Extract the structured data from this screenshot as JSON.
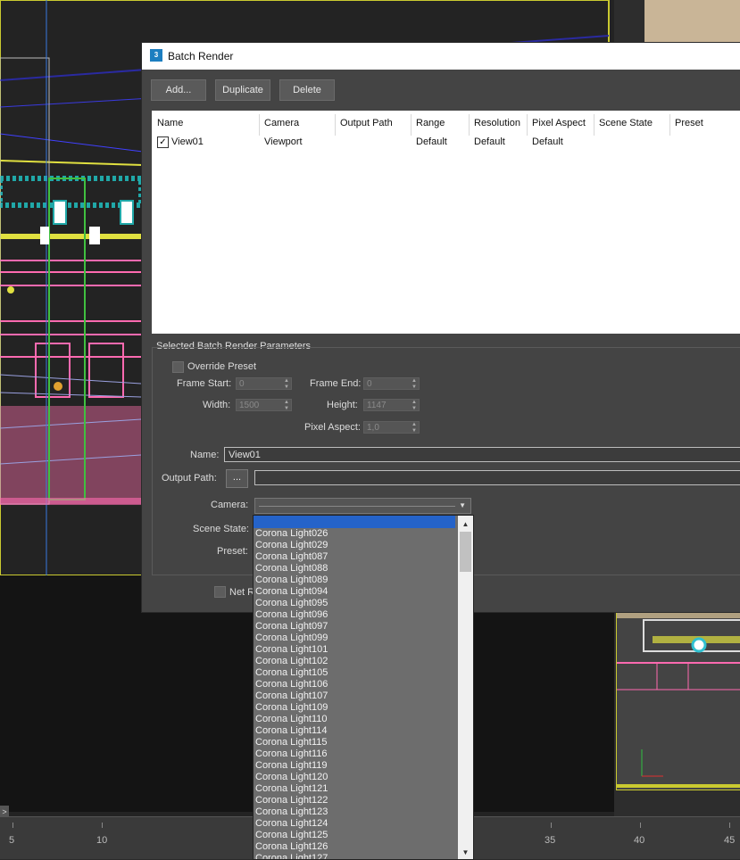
{
  "window": {
    "title": "Batch Render",
    "icon": "3ds-max-icon"
  },
  "toolbar": {
    "add_label": "Add...",
    "duplicate_label": "Duplicate",
    "delete_label": "Delete"
  },
  "table": {
    "columns": [
      "Name",
      "Camera",
      "Output Path",
      "Range",
      "Resolution",
      "Pixel Aspect",
      "Scene State",
      "Preset"
    ],
    "rows": [
      {
        "checked": true,
        "name": "View01",
        "camera": "Viewport",
        "output_path": "",
        "range": "Default",
        "resolution": "Default",
        "pixel_aspect": "Default",
        "scene_state": "",
        "preset": ""
      }
    ]
  },
  "params": {
    "section_label": "Selected Batch Render Parameters",
    "override_preset_label": "Override Preset",
    "frame_start_label": "Frame Start:",
    "frame_start_value": "0",
    "frame_end_label": "Frame End:",
    "frame_end_value": "0",
    "width_label": "Width:",
    "width_value": "1500",
    "height_label": "Height:",
    "height_value": "1147",
    "pixel_aspect_label": "Pixel Aspect:",
    "pixel_aspect_value": "1,0",
    "name_label": "Name:",
    "name_value": "View01",
    "output_path_label": "Output Path:",
    "browse_label": "...",
    "output_path_value": "",
    "camera_label": "Camera:",
    "scene_state_label": "Scene State:",
    "preset_label": "Preset:",
    "net_render_label": "Net R"
  },
  "camera_dropdown": {
    "items": [
      "Corona Light026",
      "Corona Light029",
      "Corona Light087",
      "Corona Light088",
      "Corona Light089",
      "Corona Light094",
      "Corona Light095",
      "Corona Light096",
      "Corona Light097",
      "Corona Light099",
      "Corona Light101",
      "Corona Light102",
      "Corona Light105",
      "Corona Light106",
      "Corona Light107",
      "Corona Light109",
      "Corona Light110",
      "Corona Light114",
      "Corona Light115",
      "Corona Light116",
      "Corona Light119",
      "Corona Light120",
      "Corona Light121",
      "Corona Light122",
      "Corona Light123",
      "Corona Light124",
      "Corona Light125",
      "Corona Light126",
      "Corona Light127"
    ]
  },
  "timeline": {
    "ticks": [
      "5",
      "10",
      "35",
      "40",
      "45"
    ],
    "arrow": ">"
  },
  "colors": {
    "dialog_bg": "#444444",
    "selection": "#2563c9",
    "viewport_border": "#caca30"
  }
}
